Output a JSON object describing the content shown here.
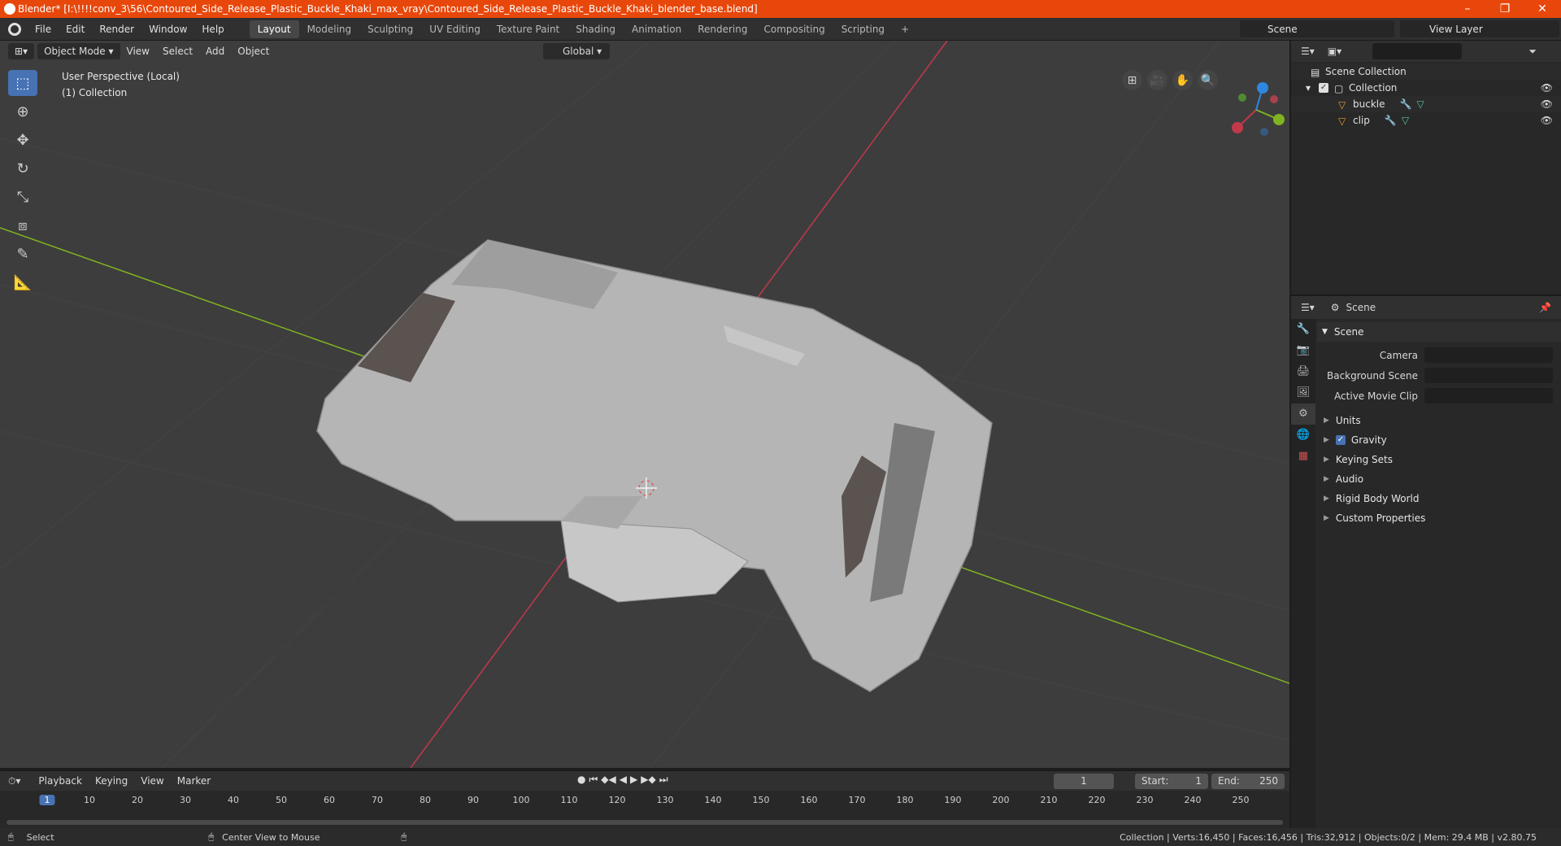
{
  "window": {
    "title": "Blender* [I:\\!!!!conv_3\\56\\Contoured_Side_Release_Plastic_Buckle_Khaki_max_vray\\Contoured_Side_Release_Plastic_Buckle_Khaki_blender_base.blend]",
    "minimize": "–",
    "maximize": "❐",
    "close": "✕"
  },
  "menu": {
    "items": [
      "File",
      "Edit",
      "Render",
      "Window",
      "Help"
    ]
  },
  "workspaces": {
    "tabs": [
      "Layout",
      "Modeling",
      "Sculpting",
      "UV Editing",
      "Texture Paint",
      "Shading",
      "Animation",
      "Rendering",
      "Compositing",
      "Scripting"
    ],
    "active": "Layout",
    "add": "+"
  },
  "scene_selector": {
    "label": "Scene"
  },
  "view_layer": {
    "label": "View Layer"
  },
  "viewport": {
    "mode": "Object Mode",
    "menus": [
      "View",
      "Select",
      "Add",
      "Object"
    ],
    "orientation": "Global",
    "info_line1": "User Perspective (Local)",
    "info_line2": "(1) Collection"
  },
  "outliner": {
    "root": "Scene Collection",
    "collection": "Collection",
    "objects": [
      "buckle",
      "clip"
    ]
  },
  "properties": {
    "context": "Scene",
    "panel": "Scene",
    "fields": {
      "camera": "Camera",
      "background_scene": "Background Scene",
      "active_movie_clip": "Active Movie Clip"
    },
    "subpanels": [
      "Units",
      "Gravity",
      "Keying Sets",
      "Audio",
      "Rigid Body World",
      "Custom Properties"
    ]
  },
  "timeline": {
    "menus": [
      "Playback",
      "Keying",
      "View",
      "Marker"
    ],
    "current_frame": "1",
    "start_label": "Start:",
    "start": "1",
    "end_label": "End:",
    "end": "250",
    "ticks": [
      "1",
      "10",
      "20",
      "30",
      "40",
      "50",
      "60",
      "70",
      "80",
      "90",
      "100",
      "110",
      "120",
      "130",
      "140",
      "150",
      "160",
      "170",
      "180",
      "190",
      "200",
      "210",
      "220",
      "230",
      "240",
      "250"
    ]
  },
  "status": {
    "left_action": "Select",
    "mid_action": "Center View to Mouse",
    "stats": "Collection | Verts:16,450 | Faces:16,456 | Tris:32,912 | Objects:0/2 | Mem: 29.4 MB | v2.80.75"
  },
  "colors": {
    "titlebar": "#e8470b",
    "accent": "#4772b3",
    "viewport_bg": "#3d3d3d",
    "x_axis": "#c0394b",
    "y_axis": "#7fb321",
    "z_axis": "#2e88e0"
  }
}
